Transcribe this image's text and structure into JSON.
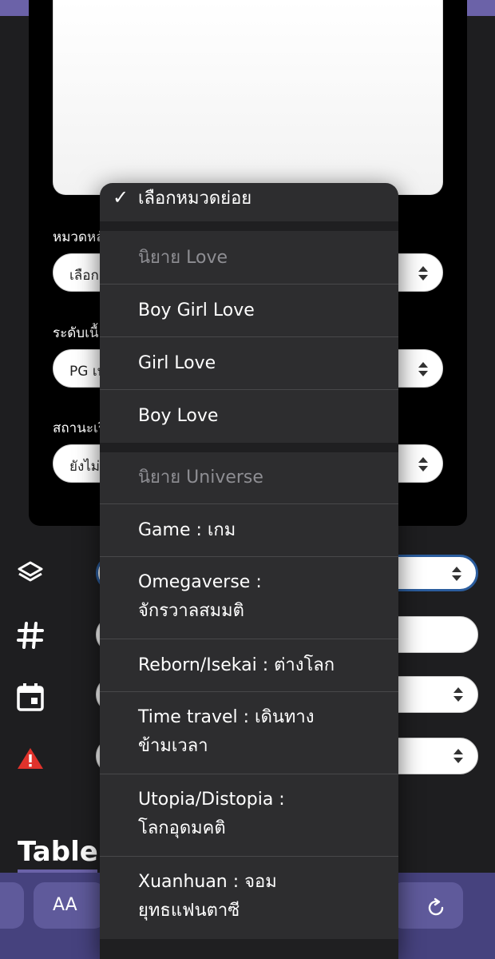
{
  "form": {
    "labels": [
      "หมวดหลัก",
      "ระดับเนื้อหา",
      "สถานะเรื่อง"
    ],
    "values": [
      "เลือก",
      "PG เห",
      "ยังไม่"
    ]
  },
  "side_icons": [
    "layers-icon",
    "hashtag-icon",
    "calendar-icon",
    "warning-icon"
  ],
  "table_title": "Table",
  "toolbar": {
    "aa_label": "AA"
  },
  "menu": {
    "items": [
      {
        "label": "เลือกหมวดย่อย",
        "type": "selected"
      },
      {
        "label": "นิยาย Love",
        "type": "header"
      },
      {
        "label": "Boy Girl Love",
        "type": "option"
      },
      {
        "label": "Girl Love",
        "type": "option"
      },
      {
        "label": "Boy Love",
        "type": "option"
      },
      {
        "label": "นิยาย Universe",
        "type": "header"
      },
      {
        "label": "Game : เกม",
        "type": "option"
      },
      {
        "label": "Omegaverse :\nจักรวาลสมมติ",
        "type": "option"
      },
      {
        "label": "Reborn/Isekai : ต่างโลก",
        "type": "option"
      },
      {
        "label": "Time travel : เดินทาง\nข้ามเวลา",
        "type": "option"
      },
      {
        "label": "Utopia/Distopia :\nโลกอุดมคติ",
        "type": "option"
      },
      {
        "label": "Xuanhuan : จอม\nยุทธแฟนตาซี",
        "type": "option"
      }
    ]
  },
  "colors": {
    "accent": "#6b62a8",
    "toolbar": "#46427e",
    "menu_bg": "#2d2d2f",
    "header_text": "#8e8e93",
    "warning": "#e0322b",
    "focus_border": "#2b5d9e"
  }
}
